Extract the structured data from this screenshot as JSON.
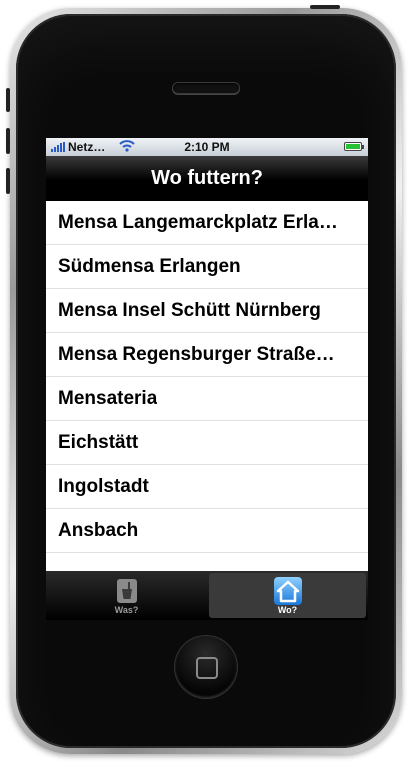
{
  "status": {
    "carrier": "Netz…",
    "time": "2:10 PM"
  },
  "navbar": {
    "title": "Wo futtern?"
  },
  "list": {
    "items": [
      "Mensa Langemarckplatz Erla…",
      "Südmensa Erlangen",
      "Mensa Insel Schütt Nürnberg",
      "Mensa Regensburger Straße…",
      "Mensateria",
      "Eichstätt",
      "Ingolstadt",
      "Ansbach"
    ]
  },
  "tabs": [
    {
      "label": "Was?",
      "icon": "cup-icon",
      "active": false
    },
    {
      "label": "Wo?",
      "icon": "house-icon",
      "active": true
    }
  ],
  "colors": {
    "accent": "#2a5cc9",
    "battery": "#27c234",
    "activeTabIcon": "#3aa0ff"
  }
}
